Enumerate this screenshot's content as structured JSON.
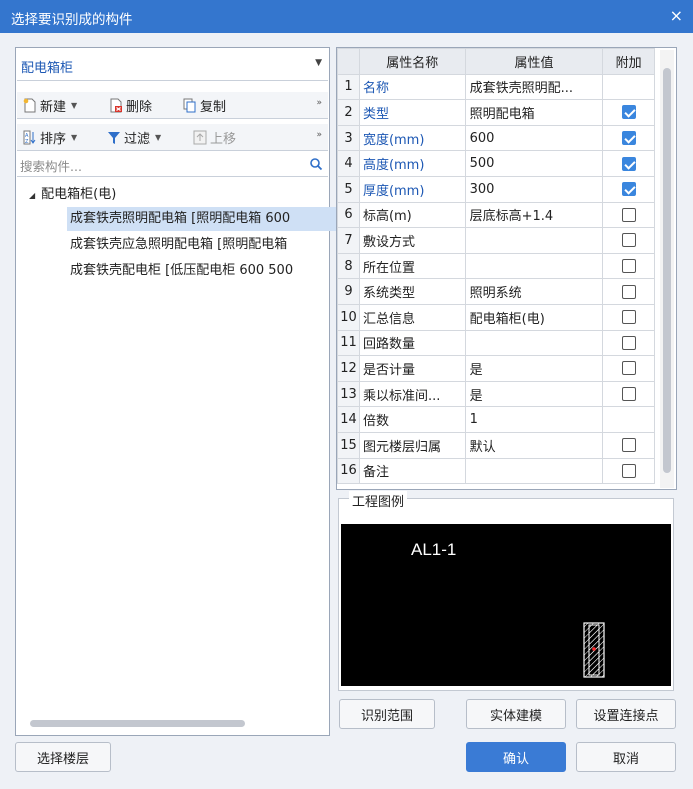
{
  "window": {
    "title": "选择要识别成的构件",
    "close_glyph": "×"
  },
  "left": {
    "component_type": "配电箱柜",
    "toolbar1": {
      "new": "新建",
      "delete": "删除",
      "copy": "复制"
    },
    "toolbar2": {
      "sort": "排序",
      "filter": "过滤",
      "move_up": "上移"
    },
    "search_placeholder": "搜索构件...",
    "tree": {
      "root": "配电箱柜(电)",
      "items": [
        "成套铁壳照明配电箱 [照明配电箱 600",
        "成套铁壳应急照明配电箱 [照明配电箱",
        "成套铁壳配电柜 [低压配电柜 600 500"
      ]
    }
  },
  "properties": {
    "headers": {
      "name": "属性名称",
      "value": "属性值",
      "extra": "附加"
    },
    "rows": [
      {
        "num": "1",
        "name": "名称",
        "value": "成套铁壳照明配...",
        "checked": null,
        "blue": true
      },
      {
        "num": "2",
        "name": "类型",
        "value": "照明配电箱",
        "checked": true,
        "blue": true
      },
      {
        "num": "3",
        "name": "宽度(mm)",
        "value": "600",
        "checked": true,
        "blue": true
      },
      {
        "num": "4",
        "name": "高度(mm)",
        "value": "500",
        "checked": true,
        "blue": true
      },
      {
        "num": "5",
        "name": "厚度(mm)",
        "value": "300",
        "checked": true,
        "blue": true
      },
      {
        "num": "6",
        "name": "标高(m)",
        "value": "层底标高+1.4",
        "checked": false,
        "blue": false
      },
      {
        "num": "7",
        "name": "敷设方式",
        "value": "",
        "checked": false,
        "blue": false
      },
      {
        "num": "8",
        "name": "所在位置",
        "value": "",
        "checked": false,
        "blue": false
      },
      {
        "num": "9",
        "name": "系统类型",
        "value": "照明系统",
        "checked": false,
        "blue": false
      },
      {
        "num": "10",
        "name": "汇总信息",
        "value": "配电箱柜(电)",
        "checked": false,
        "blue": false
      },
      {
        "num": "11",
        "name": "回路数量",
        "value": "",
        "checked": false,
        "blue": false
      },
      {
        "num": "12",
        "name": "是否计量",
        "value": "是",
        "checked": false,
        "blue": false
      },
      {
        "num": "13",
        "name": "乘以标准间...",
        "value": "是",
        "checked": false,
        "blue": false
      },
      {
        "num": "14",
        "name": "倍数",
        "value": "1",
        "checked": null,
        "blue": false
      },
      {
        "num": "15",
        "name": "图元楼层归属",
        "value": "默认",
        "checked": false,
        "blue": false
      },
      {
        "num": "16",
        "name": "备注",
        "value": "",
        "checked": false,
        "blue": false
      }
    ]
  },
  "legend": {
    "title": "工程图例",
    "label": "AL1-1"
  },
  "buttons": {
    "identify_range": "识别范围",
    "solid_model": "实体建模",
    "set_connection": "设置连接点",
    "select_floor": "选择楼层",
    "ok": "确认",
    "cancel": "取消"
  },
  "colors": {
    "titlebar": "#3476ce",
    "accent": "#3a7bd5",
    "selected_row": "#cfe0f5",
    "link_text": "#1d58b4"
  }
}
